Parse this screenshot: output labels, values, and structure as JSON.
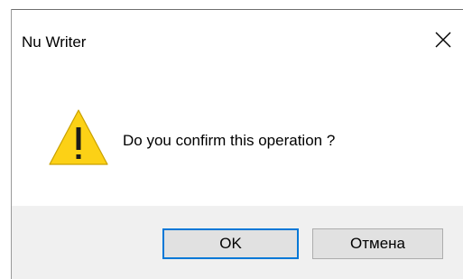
{
  "dialog": {
    "title": "Nu Writer",
    "message": "Do you confirm this operation ?",
    "icon": "warning-icon",
    "close_icon": "close-icon"
  },
  "buttons": {
    "ok_label": "OK",
    "cancel_label": "Отмена"
  },
  "colors": {
    "footer_bg": "#f0f0f0",
    "focus_border": "#0078d7",
    "warning_fill": "#fcd116",
    "button_bg": "#e1e1e1"
  }
}
